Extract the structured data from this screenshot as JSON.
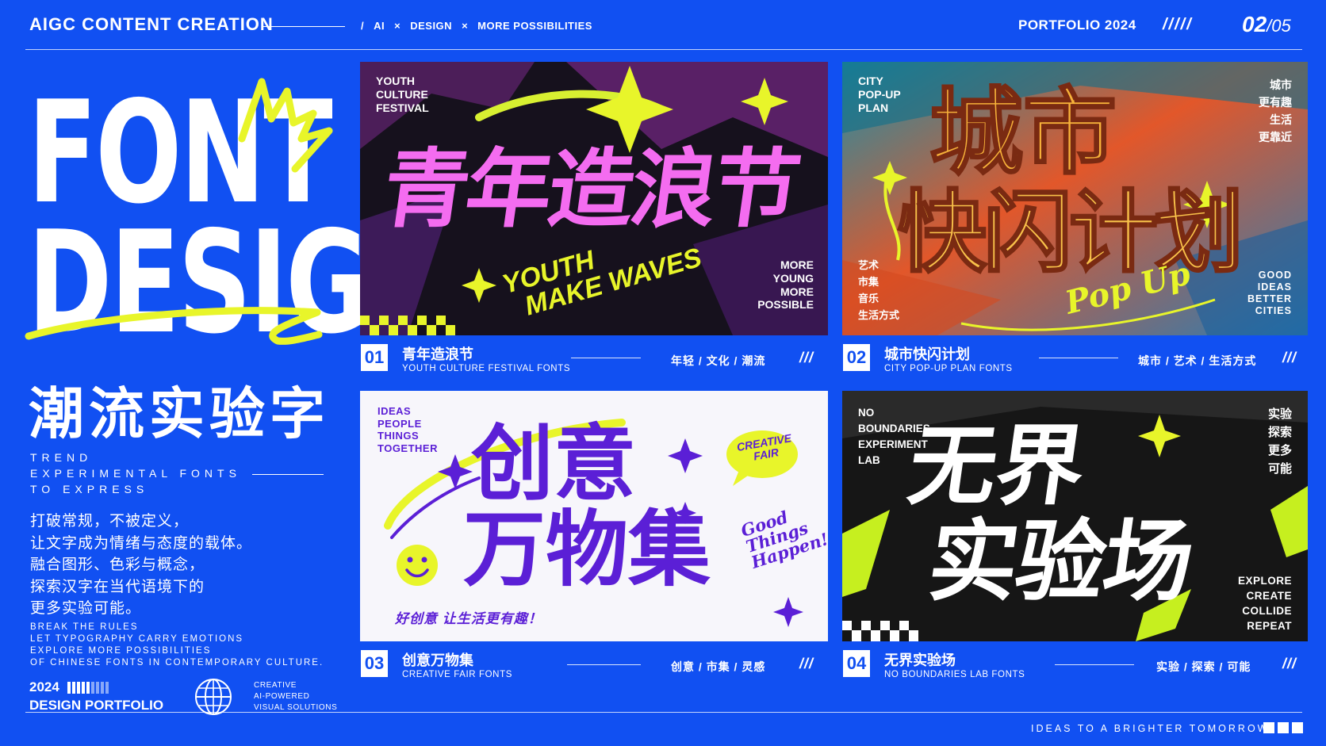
{
  "header": {
    "title": "AIGC CONTENT CREATION",
    "tags": [
      "/",
      "AI",
      "×",
      "DESIGN",
      "×",
      "MORE POSSIBILITIES"
    ],
    "portfolio": "PORTFOLIO 2024",
    "slashes": "/////",
    "page_current": "02",
    "page_total": "/05"
  },
  "left": {
    "word1": "FONT",
    "word2": "DESIGN",
    "cn_title": "潮流实验字",
    "trend_lines": [
      "TREND",
      "EXPERIMENTAL FONTS",
      "TO EXPRESS"
    ],
    "desc_cn": [
      "打破常规，不被定义，",
      "让文字成为情绪与态度的载体。",
      "融合图形、色彩与概念，",
      "探索汉字在当代语境下的",
      "更多实验可能。"
    ],
    "desc_en": [
      "BREAK THE RULES",
      "LET TYPOGRAPHY CARRY EMOTIONS",
      "EXPLORE MORE POSSIBILITIES",
      "OF CHINESE FONTS IN CONTEMPORARY CULTURE."
    ],
    "year": "2024",
    "portfolio_label": "DESIGN PORTFOLIO",
    "creative_note": [
      "CREATIVE",
      "AI-POWERED",
      "VISUAL SOLUTIONS"
    ]
  },
  "cards": [
    {
      "num": "01",
      "title": "青年造浪节",
      "subtitle": "YOUTH CULTURE FESTIVAL FONTS",
      "tags": "年轻 / 文化 / 潮流",
      "slash": "///",
      "art": {
        "corner_top": [
          "YOUTH",
          "CULTURE",
          "FESTIVAL"
        ],
        "headline": "青年造浪节",
        "script": [
          "YOUTH",
          "MAKE WAVES"
        ],
        "corner_bottom": [
          "MORE",
          "YOUNG",
          "MORE",
          "POSSIBLE"
        ]
      }
    },
    {
      "num": "02",
      "title": "城市快闪计划",
      "subtitle": "CITY POP-UP PLAN FONTS",
      "tags": "城市 / 艺术 / 生活方式",
      "slash": "///",
      "art": {
        "corner_top": [
          "CITY",
          "POP-UP",
          "PLAN"
        ],
        "headline_1": "城市",
        "headline_2": "快闪计划",
        "side_top": [
          "城市",
          "更有趣",
          "生活",
          "更靠近"
        ],
        "side_bottom_left": [
          "艺术",
          "市集",
          "音乐",
          "生活方式"
        ],
        "script": "Pop Up",
        "corner_bottom": [
          "GOOD",
          "IDEAS",
          "BETTER",
          "CITIES"
        ]
      }
    },
    {
      "num": "03",
      "title": "创意万物集",
      "subtitle": "CREATIVE FAIR FONTS",
      "tags": "创意 / 市集 / 灵感",
      "slash": "///",
      "art": {
        "corner_top": [
          "IDEAS",
          "PEOPLE",
          "THINGS",
          "TOGETHER"
        ],
        "headline_1": "创意",
        "headline_2": "万物集",
        "badge": [
          "CREATIVE",
          "FAIR"
        ],
        "script": [
          "Good",
          "Things",
          "Happen!"
        ],
        "slogan": "好创意  让生活更有趣！"
      }
    },
    {
      "num": "04",
      "title": "无界实验场",
      "subtitle": "NO BOUNDARIES LAB FONTS",
      "tags": "实验 / 探索 / 可能",
      "slash": "///",
      "art": {
        "corner_top": [
          "NO",
          "BOUNDARIES",
          "EXPERIMENT",
          "LAB"
        ],
        "headline_1": "无界",
        "headline_2": "实验场",
        "side_top": [
          "实验",
          "探索",
          "更多",
          "可能"
        ],
        "corner_bottom": [
          "EXPLORE",
          "CREATE",
          "COLLIDE",
          "REPEAT"
        ]
      }
    }
  ],
  "footer": {
    "tagline": "IDEAS TO A BRIGHTER TOMORROW"
  },
  "colors": {
    "background": "#1150f2",
    "accent_yellow": "#e8f52a",
    "pink": "#f46cf0",
    "purple": "#5b1fd6"
  }
}
